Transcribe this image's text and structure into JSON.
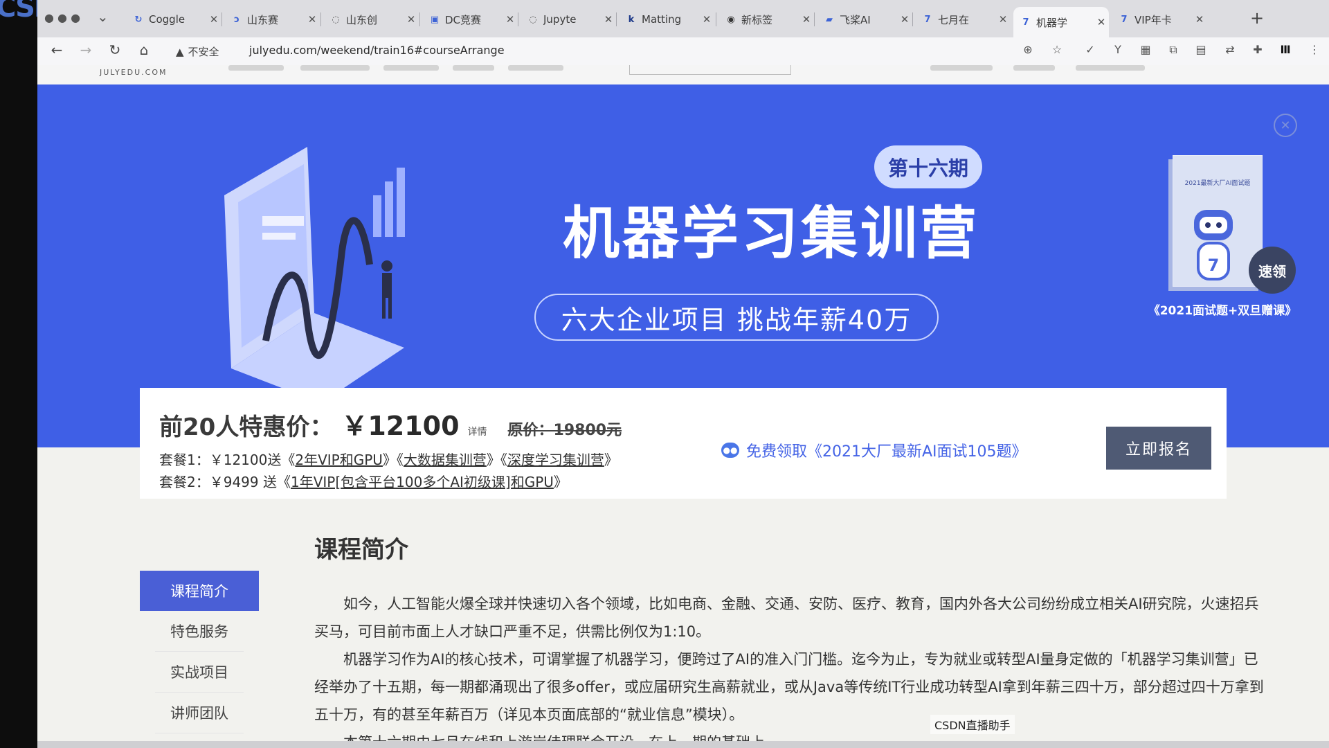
{
  "left_strip": {
    "logo_text": "CSDN"
  },
  "browser": {
    "tabs": [
      {
        "label": "Coggle",
        "favicon": "coggle-icon"
      },
      {
        "label": "山东赛",
        "favicon": "swirl-icon"
      },
      {
        "label": "山东创",
        "favicon": "loading-icon"
      },
      {
        "label": "DC竞赛",
        "favicon": "dc-icon"
      },
      {
        "label": "Jupyte",
        "favicon": "loading-icon"
      },
      {
        "label": "Matting",
        "favicon": "k-icon"
      },
      {
        "label": "新标签",
        "favicon": "chrome-icon"
      },
      {
        "label": "飞桨AI",
        "favicon": "paddle-icon"
      },
      {
        "label": "七月在",
        "favicon": "julyedu-icon"
      },
      {
        "label": "机器学",
        "favicon": "julyedu-icon",
        "active": true
      },
      {
        "label": "VIP年卡",
        "favicon": "julyedu-icon"
      }
    ],
    "security_label": "不安全",
    "url": "julyedu.com/weekend/train16#courseArrange"
  },
  "site": {
    "logo_text": "JULYEDU.COM"
  },
  "banner": {
    "badge": "第十六期",
    "title": "机器学习集训营",
    "subtitle": "六大企业项目  挑战年薪40万",
    "book_title": "2021最新大厂AI面试题",
    "quick_label": "速领",
    "book_caption": "《2021面试题+双旦赠课》"
  },
  "price": {
    "label": "前20人特惠价：",
    "value": "￥12100",
    "detail": "详情",
    "original": "原价：19800元",
    "pkg1_prefix": "套餐1：￥12100送《",
    "pkg1_link1": "2年VIP和GPU",
    "pkg1_mid1": "》《",
    "pkg1_link2": "大数据集训营",
    "pkg1_mid2": "》《",
    "pkg1_link3": "深度学习集训营",
    "pkg1_suffix": "》",
    "pkg2_prefix": "套餐2：￥9499 送《",
    "pkg2_link": "1年VIP[包含平台100多个AI初级课]和GPU",
    "pkg2_suffix": "》",
    "promo": "免费领取《2021大厂最新AI面试105题》",
    "enroll": "立即报名"
  },
  "course": {
    "section_title": "课程简介",
    "nav": [
      "课程简介",
      "特色服务",
      "实战项目",
      "讲师团队"
    ],
    "paragraphs": [
      "如今，人工智能火爆全球并快速切入各个领域，比如电商、金融、交通、安防、医疗、教育，国内外各大公司纷纷成立相关AI研究院，火速招兵买马，可目前市面上人才缺口严重不足，供需比例仅为1:10。",
      "机器学习作为AI的核心技术，可谓掌握了机器学习，便跨过了AI的准入门门槛。迄今为止，专为就业或转型AI量身定做的「机器学习集训营」已经举办了十五期，每一期都涌现出了很多offer，或应届研究生高薪就业，或从Java等传统IT行业成功转型AI拿到年薪三四十万，部分超过四十万拿到五十万，有的甚至年薪百万（详见本页面底部的“就业信息”模块）。",
      "本第十六期由七月在线和上游岸佳理联合开设，在上一期的基础上"
    ]
  },
  "overlay": {
    "watermark": "CSDN直播助手"
  },
  "colors": {
    "banner": "#3f5fe6",
    "accent": "#4463e6",
    "enroll_button": "#4f5a74",
    "nav_active": "#4a5fd6"
  }
}
